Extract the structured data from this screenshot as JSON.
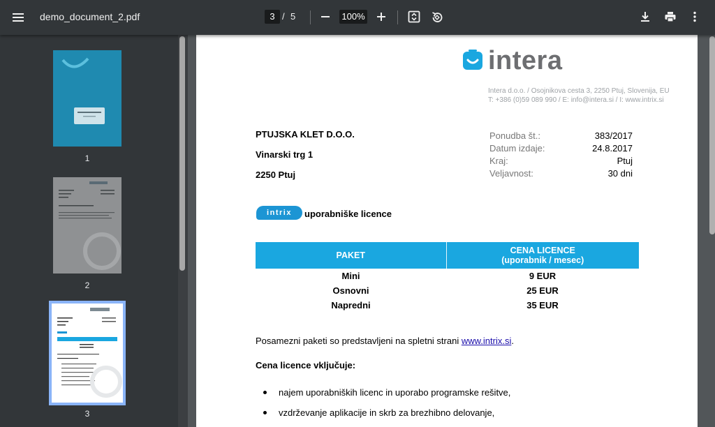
{
  "toolbar": {
    "title": "demo_document_2.pdf",
    "current_page": "3",
    "page_separator": "/",
    "total_pages": "5",
    "zoom": "100%"
  },
  "thumbnails": [
    {
      "number": "1",
      "selected": false
    },
    {
      "number": "2",
      "selected": false
    },
    {
      "number": "3",
      "selected": true
    }
  ],
  "document": {
    "logo_text": "intera",
    "address_line1": "Intera d.o.o. / Osojnikova cesta 3, 2250 Ptuj, Slovenija, EU",
    "address_line2": "T: +386 (0)59 089 990 / E: info@intera.si / I: www.intrix.si",
    "client": {
      "name": "PTUJSKA KLET D.O.O.",
      "street": "Vinarski trg 1",
      "city": "2250 Ptuj"
    },
    "meta": [
      {
        "label": "Ponudba št.:",
        "value": "383/2017"
      },
      {
        "label": "Datum izdaje:",
        "value": "24.8.2017"
      },
      {
        "label": "Kraj:",
        "value": "Ptuj"
      },
      {
        "label": "Veljavnost:",
        "value": "30 dni"
      }
    ],
    "intrix_badge": "intrix",
    "intrix_label": "uporabniške licence",
    "table": {
      "headers": [
        "PAKET",
        "CENA LICENCE",
        "(uporabnik / mesec)"
      ],
      "rows": [
        [
          "Mini",
          "9 EUR"
        ],
        [
          "Osnovni",
          "25 EUR"
        ],
        [
          "Napredni",
          "35 EUR"
        ]
      ]
    },
    "paragraph_text": "Posamezni paketi so predstavljeni na spletni strani ",
    "paragraph_link": "www.intrix.si",
    "paragraph_end": ".",
    "includes_heading": "Cena licence vključuje:",
    "bullets": [
      "najem uporabniških licenc in uporabo programske rešitve,",
      "vzdrževanje aplikacije in skrb za brezhibno delovanje,"
    ]
  },
  "colors": {
    "toolbar_bg": "#323639",
    "viewer_bg": "#525659",
    "accent_blue": "#1aa7e0",
    "thumb_selected": "#8ab4f8"
  }
}
